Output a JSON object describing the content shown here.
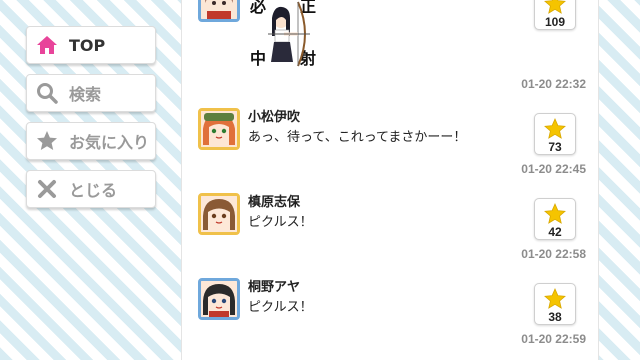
{
  "menu": {
    "top": "TOP",
    "search": "検索",
    "favorites": "お気に入り",
    "close": "とじる"
  },
  "stamp": {
    "chars": [
      "必",
      "正",
      "中",
      "射"
    ]
  },
  "messages": [
    {
      "name": "",
      "text": "",
      "time": "01-20 22:32",
      "likes": "109"
    },
    {
      "name": "小松伊吹",
      "text": "あっ、待って、これってまさかーー！",
      "time": "01-20 22:45",
      "likes": "73"
    },
    {
      "name": "槙原志保",
      "text": "ピクルス！",
      "time": "01-20 22:58",
      "likes": "42"
    },
    {
      "name": "桐野アヤ",
      "text": "ピクルス！",
      "time": "01-20 22:59",
      "likes": "38"
    }
  ],
  "colors": {
    "accent_pink": "#e8449a",
    "star_yellow": "#f5c400",
    "icon_gray": "#9a9a9a",
    "avatar_gold": "#f0c14a",
    "avatar_blue": "#6fa8dc"
  }
}
